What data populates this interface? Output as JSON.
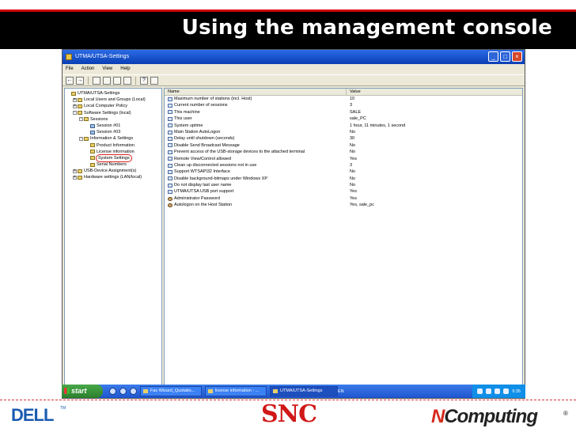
{
  "slide": {
    "title": "Using the management console"
  },
  "window": {
    "title": "UTMA/UTSA-Settings",
    "controls": [
      "_",
      "□",
      "×"
    ],
    "menu": [
      "File",
      "Action",
      "View",
      "Help"
    ]
  },
  "tree": {
    "items": [
      {
        "label": "UTMA/UTSA-Settings",
        "indent": 0,
        "icon": "folder",
        "exp": ""
      },
      {
        "label": "Local Users and Groups (Local)",
        "indent": 1,
        "icon": "folder",
        "exp": "+"
      },
      {
        "label": "Local Computer Policy",
        "indent": 1,
        "icon": "folder",
        "exp": "+"
      },
      {
        "label": "Software Settings (local)",
        "indent": 1,
        "icon": "folder",
        "exp": "-"
      },
      {
        "label": "Sessions",
        "indent": 2,
        "icon": "folder",
        "exp": "-"
      },
      {
        "label": "Session #01",
        "indent": 3,
        "icon": "pc",
        "exp": ""
      },
      {
        "label": "Session #03",
        "indent": 3,
        "icon": "pc",
        "exp": ""
      },
      {
        "label": "Information & Settings",
        "indent": 2,
        "icon": "folder",
        "exp": "-"
      },
      {
        "label": "Product Information",
        "indent": 3,
        "icon": "folder",
        "exp": ""
      },
      {
        "label": "License information",
        "indent": 3,
        "icon": "folder",
        "exp": ""
      },
      {
        "label": "System Settings",
        "indent": 3,
        "icon": "folder",
        "exp": "",
        "selected": true
      },
      {
        "label": "Serial Numbers",
        "indent": 3,
        "icon": "folder",
        "exp": ""
      },
      {
        "label": "USB-Device Assignment(s)",
        "indent": 1,
        "icon": "folder",
        "exp": "+"
      },
      {
        "label": "Hardware settings (LAN/local)",
        "indent": 1,
        "icon": "folder",
        "exp": "+"
      }
    ]
  },
  "list": {
    "col_name": "Name",
    "col_value": "Value",
    "rows": [
      {
        "name": "Maximum number of stations (incl. Host)",
        "value": "10",
        "icon": "setting"
      },
      {
        "name": "Current number of sessions",
        "value": "3",
        "icon": "setting"
      },
      {
        "name": "This machine",
        "value": "SALE",
        "icon": "setting"
      },
      {
        "name": "This user",
        "value": "sale_PC",
        "icon": "setting"
      },
      {
        "name": "System uptime",
        "value": "1 hour, 11 minutes, 1 second",
        "icon": "setting"
      },
      {
        "name": "Main Station AutoLogon",
        "value": "No",
        "icon": "setting"
      },
      {
        "name": "Delay until shutdown (seconds)",
        "value": "30",
        "icon": "setting"
      },
      {
        "name": "Disable Send Broadcast Message",
        "value": "No",
        "icon": "setting"
      },
      {
        "name": "Prevent access of the USB-storage devices to the attached terminal",
        "value": "No",
        "icon": "setting"
      },
      {
        "name": "Remote View/Control allowed",
        "value": "Yes",
        "icon": "setting"
      },
      {
        "name": "Clean up disconnected sessions not in use",
        "value": "3",
        "icon": "setting"
      },
      {
        "name": "Support WTSAPI32 Interface",
        "value": "No",
        "icon": "setting"
      },
      {
        "name": "Disable background-bitmaps under Windows XP",
        "value": "No",
        "icon": "setting"
      },
      {
        "name": "Do not display last user name",
        "value": "No",
        "icon": "setting"
      },
      {
        "name": "UTMA/UTSA USB port support",
        "value": "Yes",
        "icon": "setting"
      },
      {
        "name": "Administrator Password",
        "value": "Yes",
        "icon": "user"
      },
      {
        "name": "Autologon on the Host Station",
        "value": "Yes, sale_pc",
        "icon": "user"
      }
    ]
  },
  "taskbar": {
    "start_label": "start",
    "tasks": [
      {
        "label": "Fax Wizard_Quotatio...",
        "active": false
      },
      {
        "label": "license information - ...",
        "active": false
      },
      {
        "label": "UTMA/UTSA-Settings",
        "active": true
      }
    ],
    "language": "EN",
    "clock": "9:35"
  },
  "footer": {
    "dell": "DELL",
    "dell_tm": "TM",
    "snc": "SNC",
    "ncomputing_n": "N",
    "ncomputing_rest": "Computing",
    "registered": "®"
  }
}
